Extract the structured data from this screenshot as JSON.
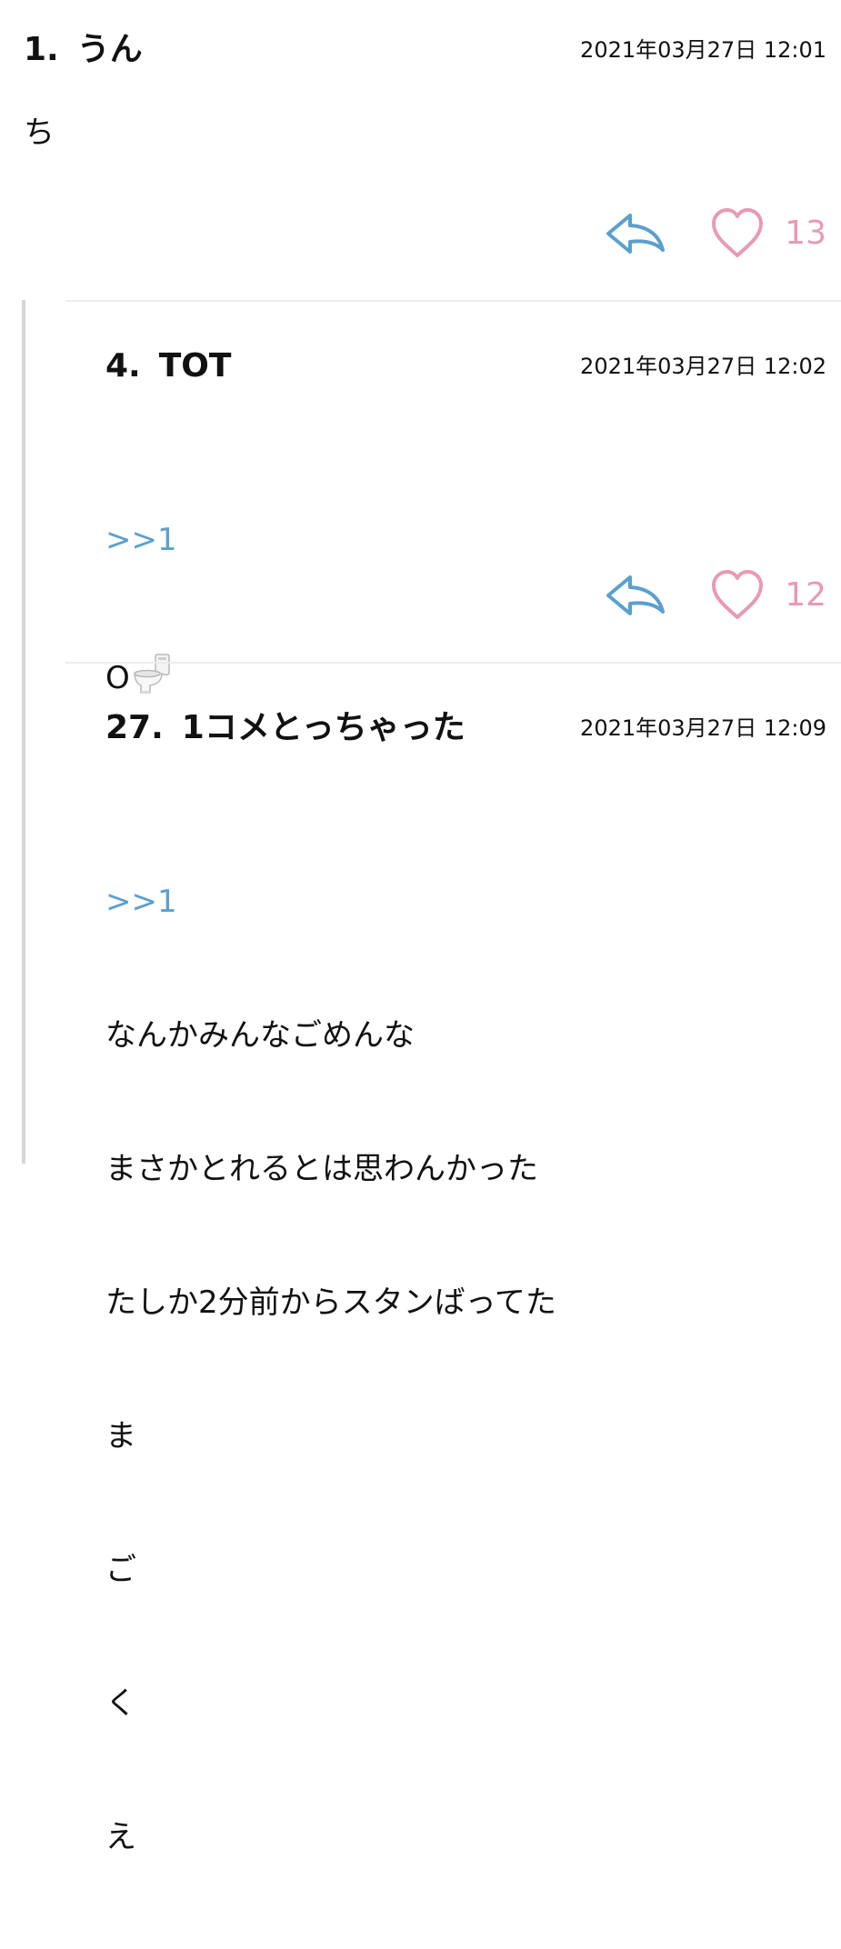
{
  "comments": [
    {
      "number": "1.",
      "name": "うん",
      "date": "2021年03月27日 12:01",
      "body": "ち",
      "likes": "13"
    }
  ],
  "replies": [
    {
      "number": "4.",
      "name": "TOT",
      "date": "2021年03月27日 12:02",
      "anchor": ">>1",
      "body": "O",
      "emoji": "toilet-emoji",
      "likes": "12"
    },
    {
      "number": "27.",
      "name": "1コメとっちゃった",
      "date": "2021年03月27日 12:09",
      "anchor": ">>1",
      "body_lines": [
        "なんかみんなごめんな",
        "まさかとれるとは思わんかった",
        "たしか2分前からスタンばってた",
        "ま",
        "ご",
        "く",
        "え"
      ]
    }
  ],
  "colors": {
    "reply_icon": "#5aa0cf",
    "heart": "#e89ab5",
    "anchor": "#5aa0cf",
    "thread_line": "#d6d6d6"
  },
  "icons": {
    "reply": "reply-arrow-icon",
    "like": "heart-icon"
  }
}
